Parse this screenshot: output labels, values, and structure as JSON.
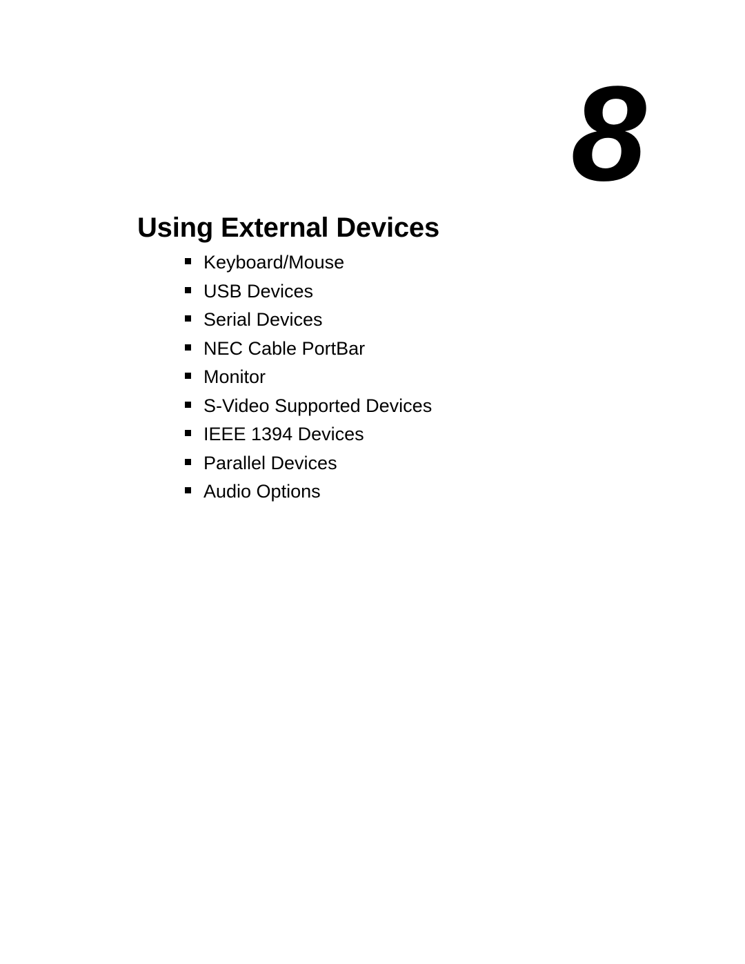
{
  "page": {
    "background_color": "#ffffff",
    "text_color": "#000000"
  },
  "chapter": {
    "number": "8",
    "title": "Using External Devices"
  },
  "contents": {
    "bullet_glyph": "square-bullet",
    "items": [
      {
        "label": "Keyboard/Mouse"
      },
      {
        "label": "USB Devices"
      },
      {
        "label": "Serial Devices"
      },
      {
        "label": "NEC Cable PortBar"
      },
      {
        "label": "Monitor"
      },
      {
        "label": "S-Video Supported Devices"
      },
      {
        "label": "IEEE 1394 Devices"
      },
      {
        "label": "Parallel Devices"
      },
      {
        "label": "Audio Options"
      }
    ]
  }
}
